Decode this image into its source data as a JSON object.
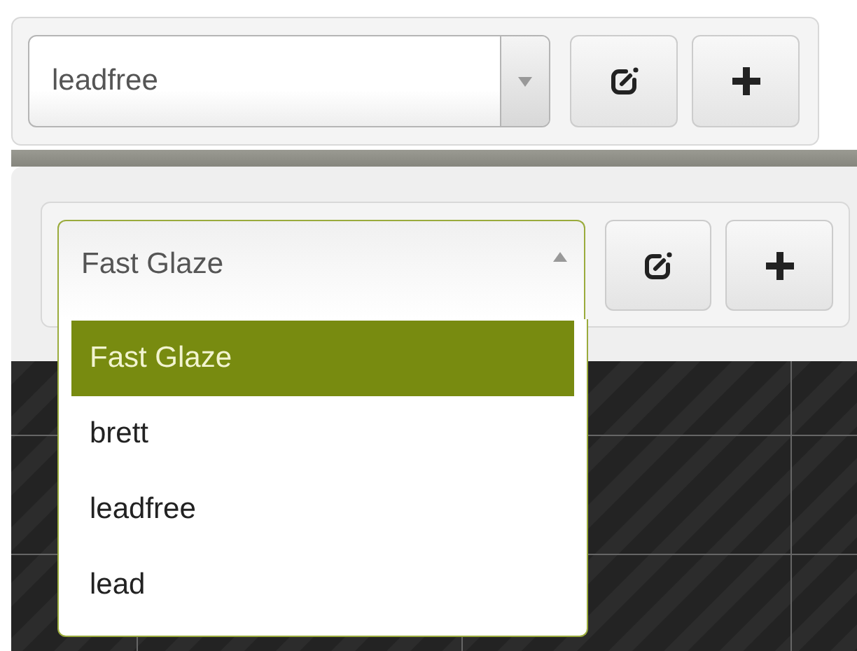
{
  "panels": [
    {
      "select": {
        "value": "leadfree",
        "expanded": false
      }
    },
    {
      "select": {
        "value": "Fast Glaze",
        "expanded": true,
        "options": [
          {
            "label": "Fast Glaze",
            "selected": true
          },
          {
            "label": "brett",
            "selected": false
          },
          {
            "label": "leadfree",
            "selected": false
          },
          {
            "label": "lead",
            "selected": false
          }
        ]
      }
    }
  ]
}
